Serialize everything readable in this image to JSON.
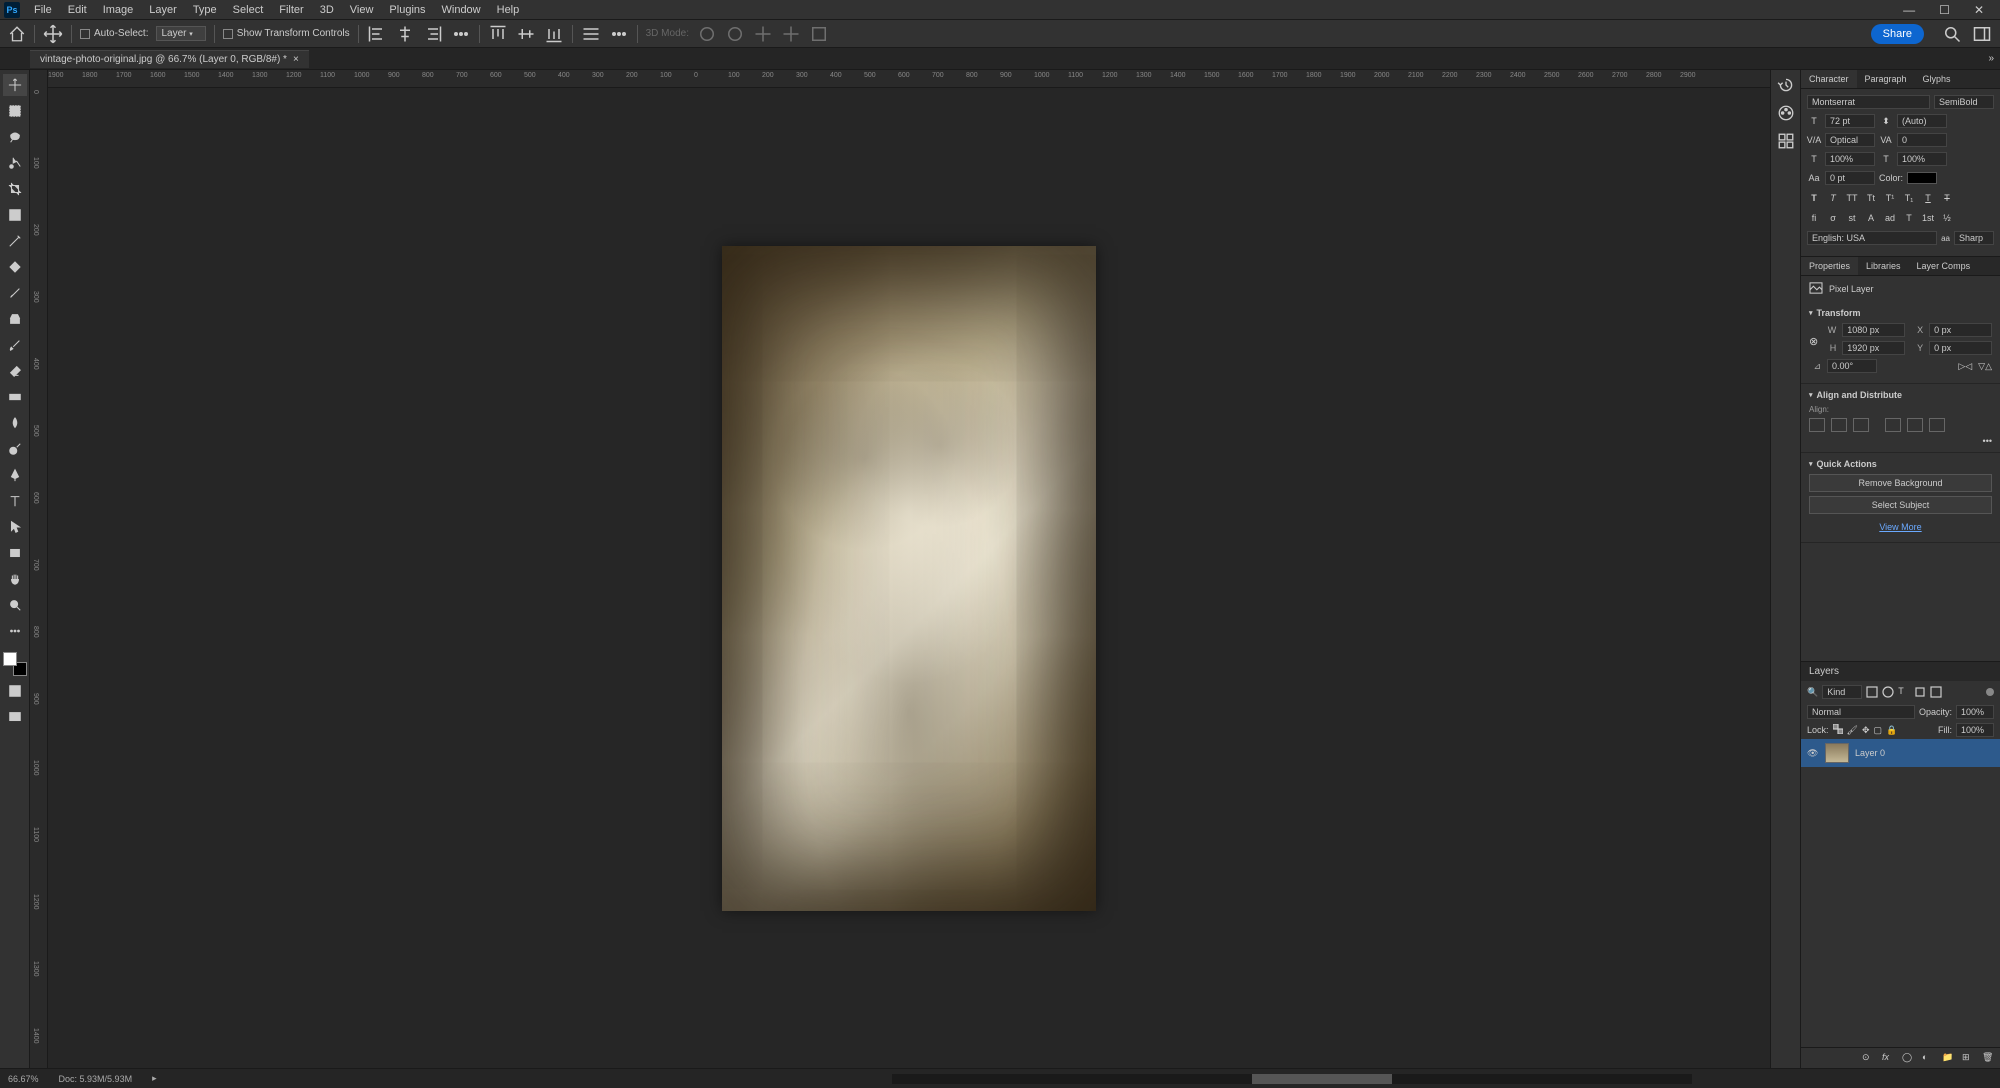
{
  "app": {
    "logo": "Ps"
  },
  "menu": [
    "File",
    "Edit",
    "Image",
    "Layer",
    "Type",
    "Select",
    "Filter",
    "3D",
    "View",
    "Plugins",
    "Window",
    "Help"
  ],
  "options": {
    "auto_select": "Auto-Select:",
    "layer_dropdown": "Layer",
    "show_transform": "Show Transform Controls",
    "mode_3d": "3D Mode:",
    "share": "Share"
  },
  "tab": {
    "title": "vintage-photo-original.jpg @ 66.7% (Layer 0, RGB/8#) *"
  },
  "ruler_h": [
    "1900",
    "1800",
    "1700",
    "1600",
    "1500",
    "1400",
    "1300",
    "1200",
    "1100",
    "1000",
    "900",
    "800",
    "700",
    "600",
    "500",
    "400",
    "300",
    "200",
    "100",
    "0",
    "100",
    "200",
    "300",
    "400",
    "500",
    "600",
    "700",
    "800",
    "900",
    "1000",
    "1100",
    "1200",
    "1300",
    "1400",
    "1500",
    "1600",
    "1700",
    "1800",
    "1900",
    "2000",
    "2100",
    "2200",
    "2300",
    "2400",
    "2500",
    "2600",
    "2700",
    "2800",
    "2900"
  ],
  "ruler_v": [
    "0",
    "100",
    "200",
    "300",
    "400",
    "500",
    "600",
    "700",
    "800",
    "900",
    "1000",
    "1100",
    "1200",
    "1300",
    "1400"
  ],
  "character": {
    "tabs": [
      "Character",
      "Paragraph",
      "Glyphs"
    ],
    "font_family": "Montserrat",
    "font_style": "SemiBold",
    "font_size": "72 pt",
    "leading": "(Auto)",
    "kerning": "Optical",
    "tracking": "0",
    "vscale": "100%",
    "hscale": "100%",
    "baseline": "0 pt",
    "color_label": "Color:",
    "language": "English: USA",
    "aa": "Sharp"
  },
  "properties": {
    "tabs": [
      "Properties",
      "Libraries",
      "Layer Comps"
    ],
    "layer_type": "Pixel Layer",
    "transform": {
      "title": "Transform",
      "w": "1080 px",
      "x": "0 px",
      "h": "1920 px",
      "y": "0 px",
      "angle": "0.00°"
    },
    "align": {
      "title": "Align and Distribute",
      "label": "Align:"
    },
    "quick_actions": {
      "title": "Quick Actions",
      "remove_bg": "Remove Background",
      "select_subject": "Select Subject",
      "view_more": "View More"
    }
  },
  "layers": {
    "title": "Layers",
    "kind": "Kind",
    "blend": "Normal",
    "opacity_label": "Opacity:",
    "opacity": "100%",
    "lock_label": "Lock:",
    "fill_label": "Fill:",
    "fill": "100%",
    "layer0": "Layer 0"
  },
  "status": {
    "zoom": "66.67%",
    "doc": "Doc: 5.93M/5.93M"
  }
}
